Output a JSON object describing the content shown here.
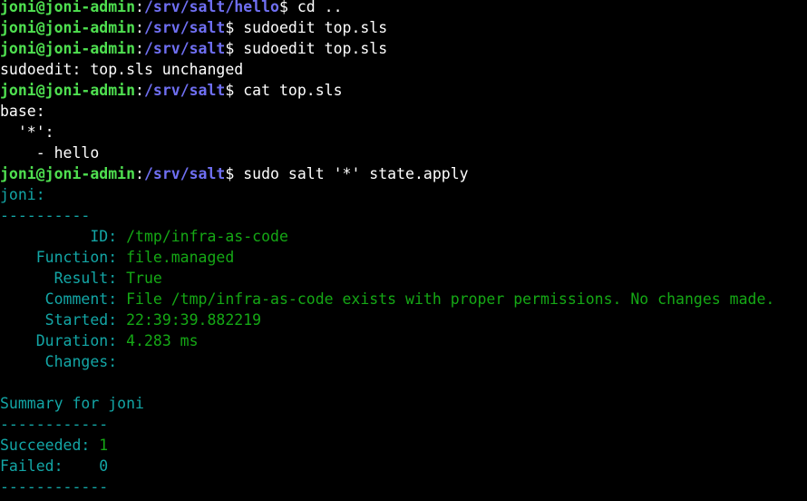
{
  "prompt_user_host": "joni@joni-admin",
  "prompt_colon": ":",
  "prompt_dollar": "$ ",
  "path_hello": "/srv/salt/hello",
  "path_salt": "/srv/salt",
  "cmd_cd": "cd ..",
  "cmd_sudoedit": "sudoedit top.sls",
  "msg_unchanged": "sudoedit: top.sls unchanged",
  "cmd_cat": "cat top.sls",
  "file_line1": "base:",
  "file_line2": "  '*':",
  "file_line3": "    - hello",
  "cmd_salt": "sudo salt '*' state.apply",
  "minion": "joni:",
  "sep_short": "----------",
  "fields": {
    "id_label": "          ID: ",
    "id_value": "/tmp/infra-as-code",
    "function_label": "    Function: ",
    "function_value": "file.managed",
    "result_label": "      Result: ",
    "result_value": "True",
    "comment_label": "     Comment: ",
    "comment_value": "File /tmp/infra-as-code exists with proper permissions. No changes made.",
    "started_label": "     Started: ",
    "started_value": "22:39:39.882219",
    "duration_label": "    Duration: ",
    "duration_value": "4.283 ms",
    "changes_label": "     Changes:"
  },
  "summary_title": "Summary for joni",
  "sep_long": "------------",
  "succeeded_label": "Succeeded: ",
  "succeeded_value": "1",
  "failed_label": "Failed:    ",
  "failed_value": "0",
  "colors": {
    "prompt_green": "#4fe050",
    "path_blue": "#6f6ff2",
    "cyan": "#13a6a6",
    "green": "#15a815",
    "background": "#000000"
  }
}
